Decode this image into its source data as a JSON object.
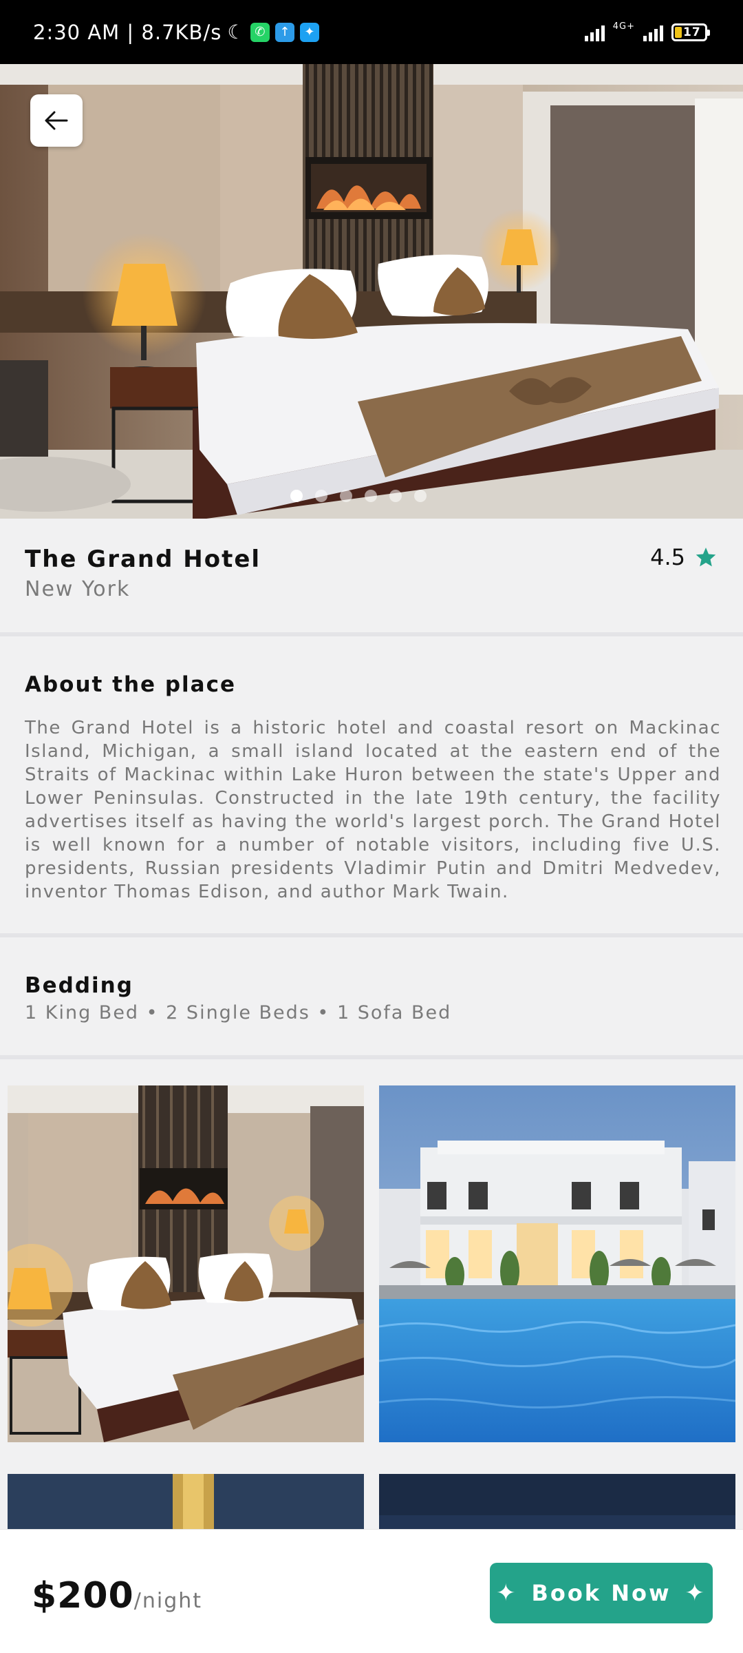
{
  "status_bar": {
    "time_speed": "2:30 AM | 8.7KB/s",
    "network": "4G+",
    "battery": "17"
  },
  "hotel": {
    "name": "The Grand Hotel",
    "location": "New York",
    "rating": "4.5"
  },
  "about": {
    "heading": "About the place",
    "text": "The Grand Hotel is a historic hotel and coastal resort on Mackinac Island, Michigan, a small island located at the eastern end of the Straits of Mackinac within Lake Huron between the state's Upper and Lower Peninsulas. Constructed in the late 19th century, the facility advertises itself as having the world's largest porch. The Grand Hotel is well known for a number of notable visitors, including five U.S. presidents, Russian presidents Vladimir Putin and Dmitri Medvedev, inventor Thomas Edison, and author Mark Twain."
  },
  "bedding": {
    "heading": "Bedding",
    "text": "1 King Bed • 2 Single Beds • 1 Sofa Bed"
  },
  "carousel": {
    "count": 6,
    "active_index": 0
  },
  "booking": {
    "price": "$200",
    "unit": "/night",
    "button_label": "Book Now"
  },
  "colors": {
    "accent": "#24a38a",
    "star": "#24a38a"
  }
}
